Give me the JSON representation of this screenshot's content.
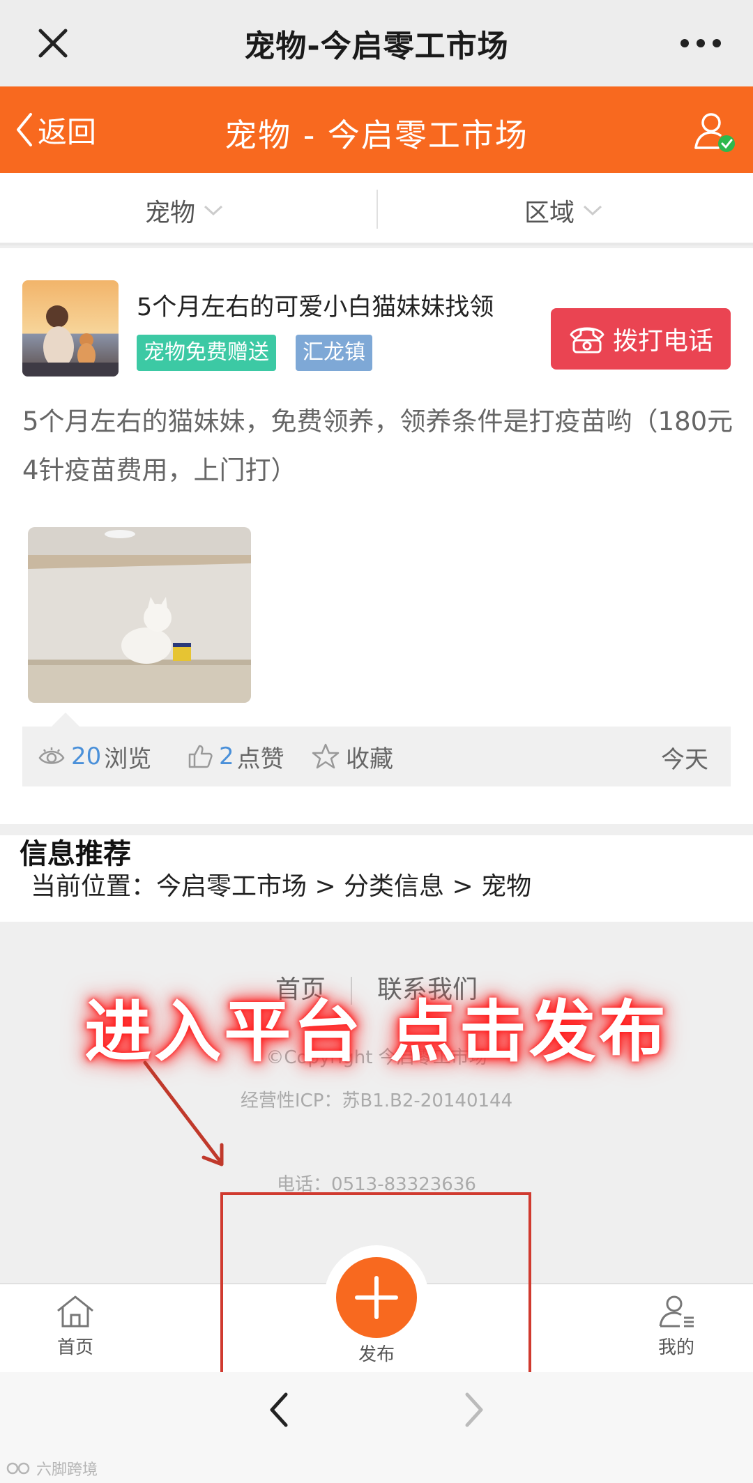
{
  "wx": {
    "title": "宠物-今启零工市场"
  },
  "header": {
    "back_label": "返回",
    "title": "宠物 - 今启零工市场"
  },
  "filters": [
    {
      "label": "宠物"
    },
    {
      "label": "区域"
    }
  ],
  "post": {
    "title": "5个月左右的可爱小白猫妹妹找领",
    "tags": [
      "宠物免费赠送",
      "汇龙镇"
    ],
    "call_label": "拨打电话",
    "description": "5个月左右的猫妹妹，免费领养，领养条件是打疫苗哟（180元4针疫苗费用，上门打）",
    "views": "20",
    "views_label": "浏览",
    "likes": "2",
    "likes_label": "点赞",
    "favorite_label": "收藏",
    "date": "今天"
  },
  "recommend": {
    "title": "信息推荐",
    "breadcrumb": "当前位置：今启零工市场 > 分类信息 > 宠物"
  },
  "footer": {
    "home_link": "首页",
    "contact_link": "联系我们",
    "copyright": "©Copyright  今启零工市场",
    "icp": "经营性ICP：苏B1.B2-20140144",
    "tel": "电话：0513-83323636"
  },
  "overlay": {
    "caption": "进入平台  点击发布"
  },
  "tabbar": {
    "home": "首页",
    "publish": "发布",
    "mine": "我的"
  },
  "watermark": "六脚跨境",
  "colors": {
    "brand_orange": "#f8691f",
    "call_red": "#ea4452",
    "tag_green": "#3cc9a4",
    "tag_blue": "#7ea8d6",
    "highlight_red": "#d03a2f"
  }
}
